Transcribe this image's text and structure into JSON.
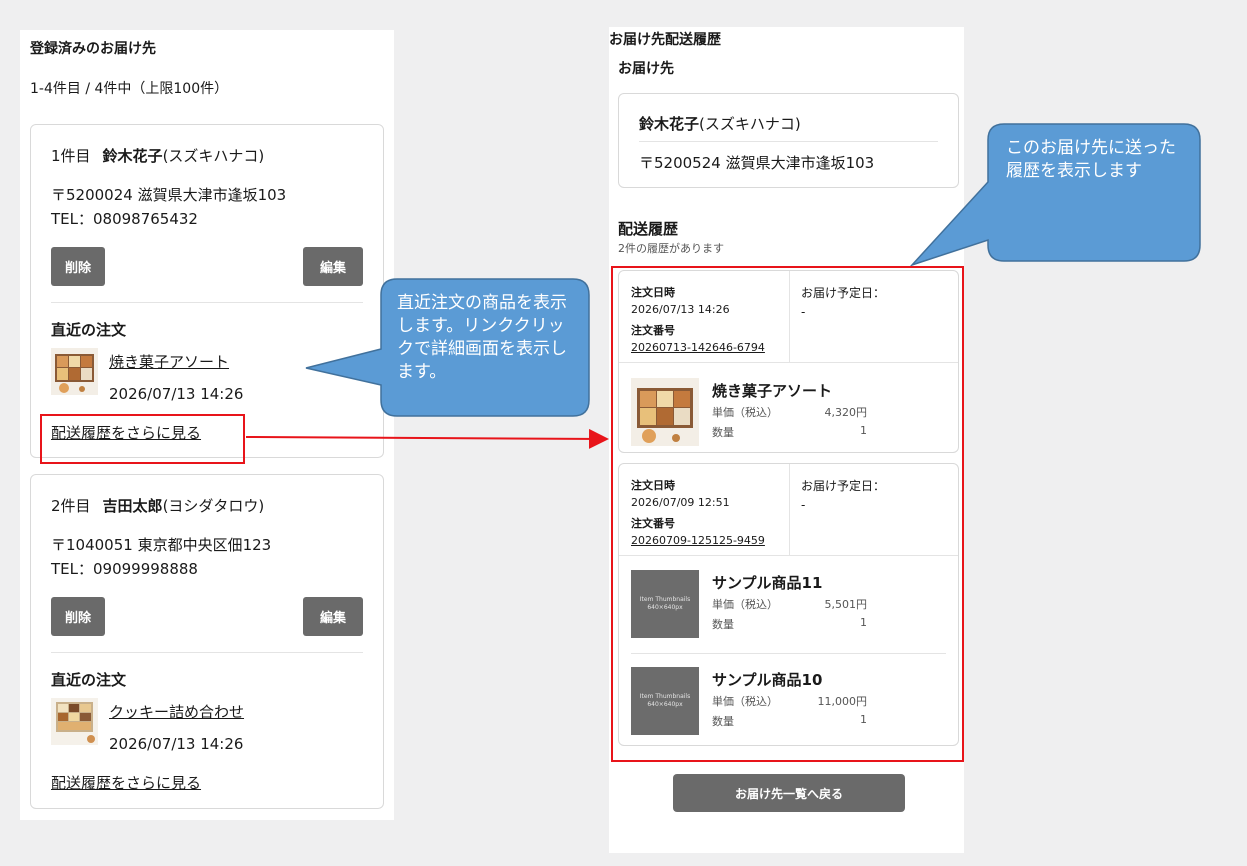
{
  "left": {
    "title": "登録済みのお届け先",
    "count": "1-4件目 / 4件中（上限100件）",
    "cards": [
      {
        "index": "1件目",
        "name": "鈴木花子",
        "kana": "(スズキハナコ)",
        "address": "〒5200024 滋賀県大津市逢坂103",
        "tel": "TEL：08098765432",
        "delete_label": "削除",
        "edit_label": "編集",
        "recent_title": "直近の注文",
        "recent_item": "焼き菓子アソート",
        "recent_date": "2026/07/13 14:26",
        "more_link": "配送履歴をさらに見る"
      },
      {
        "index": "2件目",
        "name": "吉田太郎",
        "kana": "(ヨシダタロウ)",
        "address": "〒1040051 東京都中央区佃123",
        "tel": "TEL：09099998888",
        "delete_label": "削除",
        "edit_label": "編集",
        "recent_title": "直近の注文",
        "recent_item": "クッキー詰め合わせ",
        "recent_date": "2026/07/13 14:26",
        "more_link": "配送履歴をさらに見る"
      }
    ]
  },
  "right": {
    "title": "お届け先配送履歴",
    "dest_label": "お届け先",
    "dest_name": "鈴木花子",
    "dest_kana": "(スズキハナコ)",
    "dest_address": "〒5200524 滋賀県大津市逢坂103",
    "history_title": "配送履歴",
    "history_count": "2件の履歴があります",
    "orders": [
      {
        "date_label": "注文日時",
        "date": "2026/07/13 14:26",
        "number_label": "注文番号",
        "number": "20260713-142646-6794",
        "sched_label": "お届け予定日：",
        "sched": "-",
        "items": [
          {
            "name": "焼き菓子アソート",
            "price_label": "単価（税込）",
            "price": "4,320円",
            "qty_label": "数量",
            "qty": "1"
          }
        ]
      },
      {
        "date_label": "注文日時",
        "date": "2026/07/09 12:51",
        "number_label": "注文番号",
        "number": "20260709-125125-9459",
        "sched_label": "お届け予定日：",
        "sched": "-",
        "items": [
          {
            "name": "サンプル商品11",
            "price_label": "単価（税込）",
            "price": "5,501円",
            "qty_label": "数量",
            "qty": "1",
            "thumb_text": [
              "Item Thumbnails",
              "640×640px"
            ]
          },
          {
            "name": "サンプル商品10",
            "price_label": "単価（税込）",
            "price": "11,000円",
            "qty_label": "数量",
            "qty": "1",
            "thumb_text": [
              "Item Thumbnails",
              "640×640px"
            ]
          }
        ]
      }
    ],
    "back_label": "お届け先一覧へ戻る"
  },
  "callouts": {
    "left_text": "直近注文の商品を表示します。リンククリックで詳細画面を表示します。",
    "right_text": "このお届け先に送った履歴を表示します"
  },
  "colors": {
    "annotation_red": "#e8141a",
    "callout_blue": "#5b9bd5",
    "button_gray": "#6a6a6a"
  }
}
